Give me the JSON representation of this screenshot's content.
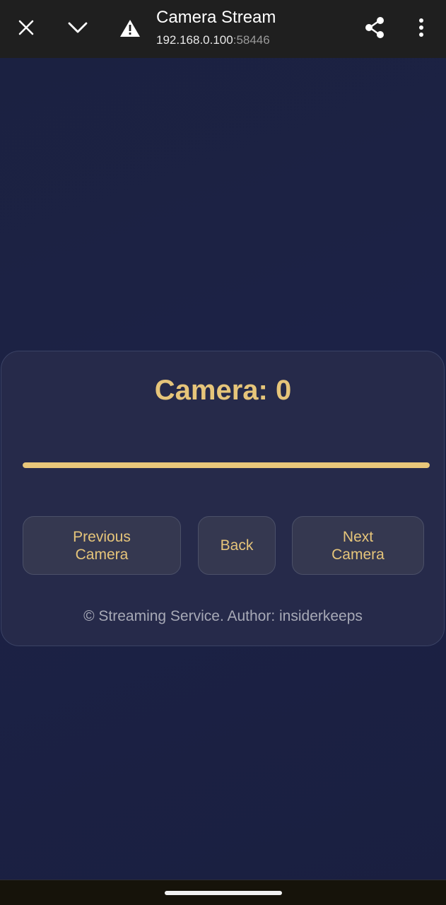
{
  "browser": {
    "title": "Camera Stream",
    "url_host": "192.168.0.100",
    "url_port": ":58446",
    "icons": {
      "close": "close-icon",
      "collapse": "chevron-down-icon",
      "security": "warning-icon",
      "share": "share-icon",
      "menu": "more-vert-icon"
    }
  },
  "stream": {
    "camera_label": "Camera: 0",
    "progress_fraction": 1.0,
    "buttons": {
      "previous": "Previous Camera",
      "back": "Back",
      "next": "Next Camera"
    },
    "footer": "© Streaming Service. Author: insiderkeeps"
  },
  "colors": {
    "accent": "#e6c57a",
    "background": "#1b2140",
    "card": "#262a4a",
    "button": "#353850"
  }
}
